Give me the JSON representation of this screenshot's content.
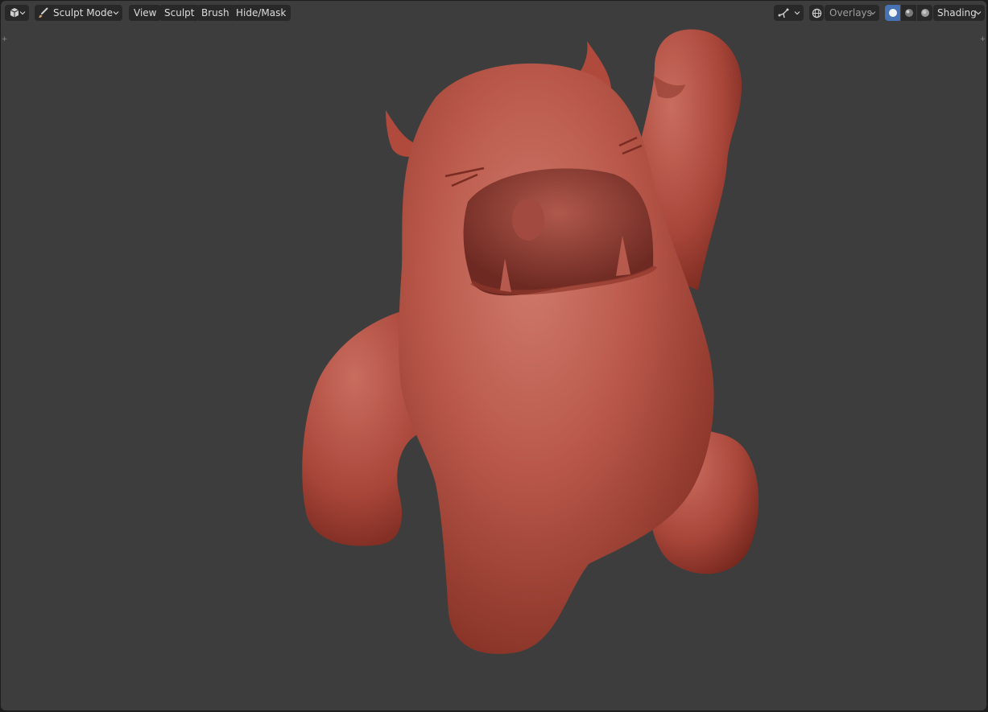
{
  "header": {
    "mode_label": "Sculpt Mode",
    "menus": [
      "View",
      "Sculpt",
      "Brush",
      "Hide/Mask"
    ],
    "overlays_label": "Overlays",
    "shading_label": "Shading"
  },
  "icons": {
    "editor_type": "cube-icon",
    "mode": "brush-icon",
    "gizmo": "gizmo-icon",
    "overlay": "overlay-globe-icon",
    "shading_modes": [
      "solid-shading-icon",
      "material-preview-icon",
      "rendered-shading-icon"
    ]
  },
  "colors": {
    "viewport_bg": "#3d3d3d",
    "header_button": "#282828",
    "active_accent": "#4772b3",
    "model_base": "#b5483a"
  }
}
